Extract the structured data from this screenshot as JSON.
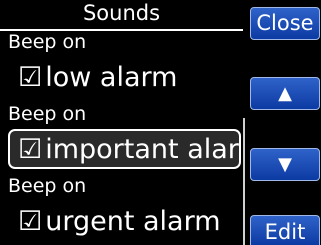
{
  "title": "Sounds",
  "groups": [
    {
      "label": "Beep on",
      "item": {
        "check": "☑",
        "text": "low alarm",
        "selected": false
      }
    },
    {
      "label": "Beep on",
      "item": {
        "check": "☑",
        "text": "important alar.",
        "selected": true
      }
    },
    {
      "label": "Beep on",
      "item": {
        "check": "☑",
        "text": "urgent alarm",
        "selected": false
      }
    }
  ],
  "buttons": {
    "close": "Close",
    "up_icon": "▲",
    "down_icon": "▼",
    "edit": "Edit"
  },
  "colors": {
    "background": "#000000",
    "button": "#1f4fb8",
    "text": "#ffffff"
  }
}
